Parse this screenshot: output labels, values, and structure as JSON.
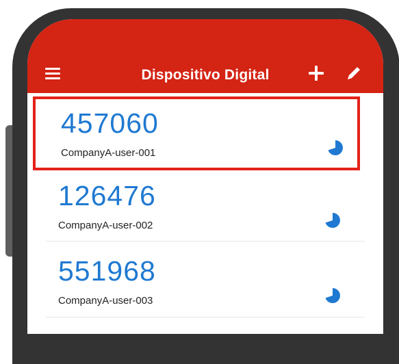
{
  "app": {
    "title": "Dispositivo Digital"
  },
  "accounts": [
    {
      "code": "457060",
      "name": "CompanyA-user-001",
      "selected": true
    },
    {
      "code": "126476",
      "name": "CompanyA-user-002",
      "selected": false
    },
    {
      "code": "551968",
      "name": "CompanyA-user-003",
      "selected": false
    }
  ],
  "colors": {
    "brand": "#d42414",
    "code": "#1f79d1",
    "highlight": "#e32219",
    "frame": "#333333"
  },
  "icons": {
    "menu": "menu-icon",
    "add": "add-icon",
    "edit": "pencil-icon",
    "timer": "countdown-pie-icon"
  }
}
